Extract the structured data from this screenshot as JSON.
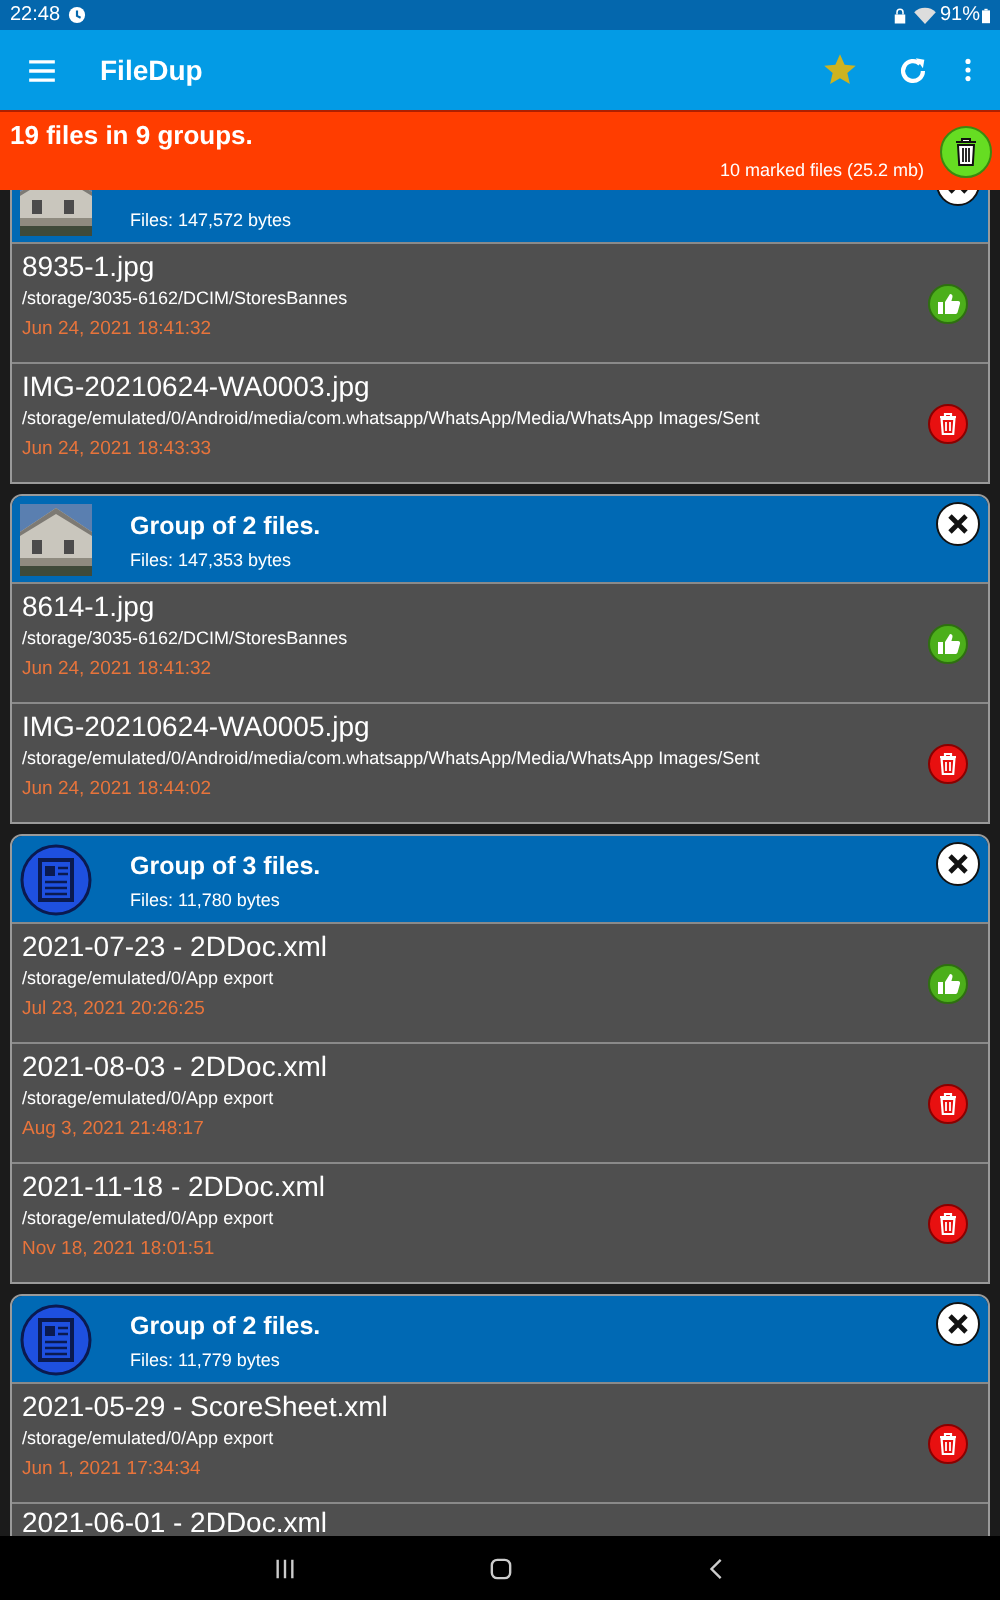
{
  "status_bar": {
    "time": "22:48",
    "battery": "91%"
  },
  "app_bar": {
    "title": "FileDup"
  },
  "banner": {
    "summary": "19 files in 9 groups.",
    "marked": "10 marked files (25.2 mb)"
  },
  "groups": [
    {
      "size": "Files:  147,572 bytes",
      "files": [
        {
          "name": "8935-1.jpg",
          "path": "/storage/3035-6162/DCIM/StoresBannes",
          "date": "Jun 24, 2021 18:41:32",
          "kind": "keep"
        },
        {
          "name": "IMG-20210624-WA0003.jpg",
          "path": "/storage/emulated/0/Android/media/com.whatsapp/WhatsApp/Media/WhatsApp Images/Sent",
          "date": "Jun 24, 2021 18:43:33",
          "kind": "delete"
        }
      ]
    },
    {
      "title": "Group of 2 files.",
      "size": "Files:  147,353 bytes",
      "files": [
        {
          "name": "8614-1.jpg",
          "path": "/storage/3035-6162/DCIM/StoresBannes",
          "date": "Jun 24, 2021 18:41:32",
          "kind": "keep"
        },
        {
          "name": "IMG-20210624-WA0005.jpg",
          "path": "/storage/emulated/0/Android/media/com.whatsapp/WhatsApp/Media/WhatsApp Images/Sent",
          "date": "Jun 24, 2021 18:44:02",
          "kind": "delete"
        }
      ]
    },
    {
      "kind": "document",
      "title": "Group of 3 files.",
      "size": "Files:  11,780 bytes",
      "files": [
        {
          "name": "2021-07-23 - 2DDoc.xml",
          "path": "/storage/emulated/0/App export",
          "date": "Jul 23, 2021 20:26:25",
          "kind": "keep"
        },
        {
          "name": "2021-08-03 - 2DDoc.xml",
          "path": "/storage/emulated/0/App export",
          "date": "Aug 3, 2021 21:48:17",
          "kind": "delete"
        },
        {
          "name": "2021-11-18 - 2DDoc.xml",
          "path": "/storage/emulated/0/App export",
          "date": "Nov 18, 2021 18:01:51",
          "kind": "delete"
        }
      ]
    },
    {
      "kind": "document",
      "title": "Group of 2 files.",
      "size": "Files:  11,779 bytes",
      "files": [
        {
          "name": "2021-05-29 - ScoreSheet.xml",
          "path": "/storage/emulated/0/App export",
          "date": "Jun 1, 2021 17:34:34",
          "kind": "delete"
        },
        {
          "name": "2021-06-01 - 2DDoc.xml"
        }
      ]
    }
  ]
}
